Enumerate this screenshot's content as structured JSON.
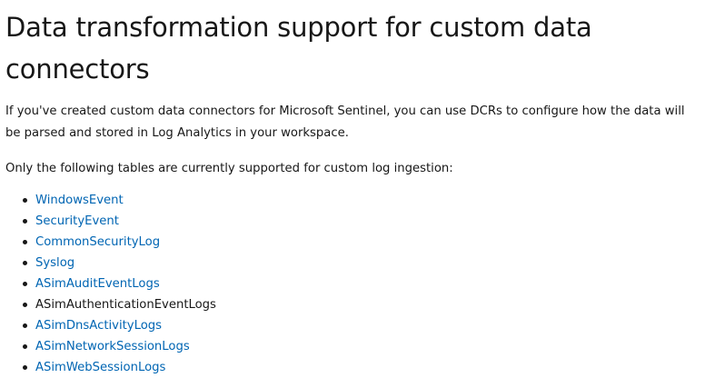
{
  "heading": "Data transformation support for custom data connectors",
  "intro": "If you've created custom data connectors for Microsoft Sentinel, you can use DCRs to configure how the data will be parsed and stored in Log Analytics in your workspace.",
  "lead": "Only the following tables are currently supported for custom log ingestion:",
  "tables": [
    {
      "label": "WindowsEvent",
      "link": true
    },
    {
      "label": "SecurityEvent",
      "link": true
    },
    {
      "label": "CommonSecurityLog",
      "link": true
    },
    {
      "label": "Syslog",
      "link": true
    },
    {
      "label": "ASimAuditEventLogs",
      "link": true
    },
    {
      "label": "ASimAuthenticationEventLogs",
      "link": false
    },
    {
      "label": "ASimDnsActivityLogs",
      "link": true
    },
    {
      "label": "ASimNetworkSessionLogs",
      "link": true
    },
    {
      "label": "ASimWebSessionLogs",
      "link": true
    }
  ],
  "colors": {
    "text": "#171717",
    "link": "#0065b3"
  }
}
